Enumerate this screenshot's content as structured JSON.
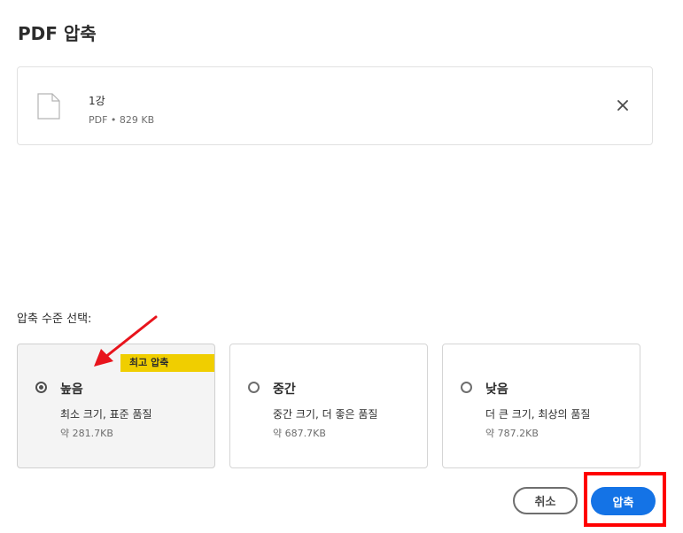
{
  "dialog": {
    "title": "PDF 압축"
  },
  "file": {
    "name": "1강",
    "meta": "PDF • 829 KB"
  },
  "compression": {
    "label": "압축 수준 선택:",
    "options": [
      {
        "title": "높음",
        "desc": "최소 크기, 표준 품질",
        "size": "약 281.7KB",
        "badge": "최고 압축",
        "selected": true
      },
      {
        "title": "중간",
        "desc": "중간 크기, 더 좋은 품질",
        "size": "약 687.7KB",
        "selected": false
      },
      {
        "title": "낮음",
        "desc": "더 큰 크기, 최상의 품질",
        "size": "약 787.2KB",
        "selected": false
      }
    ]
  },
  "buttons": {
    "cancel": "취소",
    "compress": "압축"
  },
  "colors": {
    "primary": "#1473e6",
    "badge": "#f0ce00",
    "highlight": "#ff0000",
    "annotation_arrow": "#e8141c"
  },
  "icons": {
    "file": "file-icon",
    "close": "close-icon"
  }
}
